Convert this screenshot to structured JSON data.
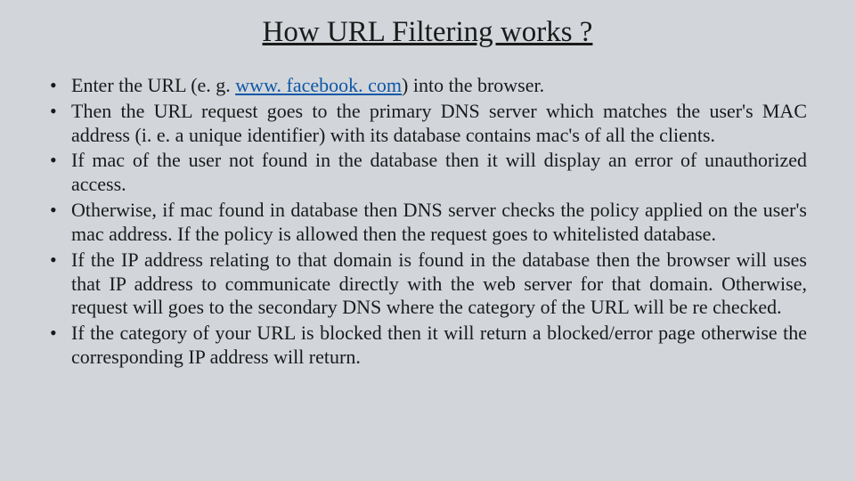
{
  "title": "How URL Filtering works ?",
  "bullets": {
    "b1_prefix": "Enter the URL (e. g. ",
    "b1_link": "www. facebook. com",
    "b1_suffix": ") into the browser.",
    "b2": "Then the URL request goes to the primary DNS server which matches the user's MAC address (i. e. a unique identifier) with its database contains mac's of all the clients.",
    "b3": "If mac of the user not found in the database then it will display an error of unauthorized access.",
    "b4": "Otherwise, if mac found in database then DNS server checks the policy applied on the user's mac address. If the policy is allowed then the request goes to whitelisted database.",
    "b5": "If the IP address relating to that domain is found in the database then the  browser will uses that IP address to communicate directly with the web server for that domain. Otherwise, request will goes to the secondary DNS where the category of the URL will be re checked.",
    "b6": "If the category of your URL is blocked then it will return a blocked/error page otherwise  the corresponding IP address will return."
  }
}
